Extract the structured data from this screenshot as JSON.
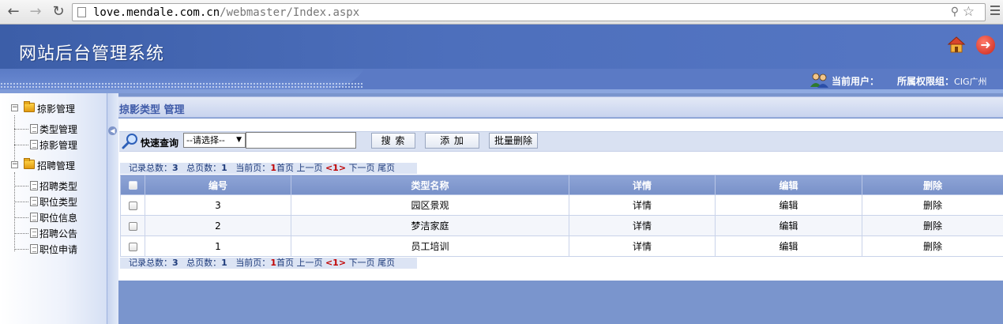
{
  "browser": {
    "url_host": "love.mendale.com.cn",
    "url_path": "/webmaster/Index.aspx"
  },
  "header": {
    "app_title": "网站后台管理系统",
    "current_user_label": "当前用户：",
    "group_label": "所属权限组：",
    "group_value": "CIG广州"
  },
  "sidebar": {
    "groups": [
      {
        "label": "掠影管理",
        "items": [
          "类型管理",
          "掠影管理"
        ]
      },
      {
        "label": "招聘管理",
        "items": [
          "招聘类型",
          "职位类型",
          "职位信息",
          "招聘公告",
          "职位申请"
        ]
      }
    ]
  },
  "panel": {
    "title": "掠影类型 管理"
  },
  "toolbar": {
    "quick_search_label": "快速查询",
    "select_value": "--请选择--",
    "search_value": "",
    "search_button": "搜 索",
    "add_button": "添 加",
    "batch_delete_button": "批量删除"
  },
  "pager": {
    "total_label": "记录总数：",
    "total": "3",
    "pages_label": "总页数：",
    "pages": "1",
    "current_label": "当前页：",
    "current": "1",
    "first": "首页",
    "prev": "上一页",
    "page_link": "<1>",
    "next": "下一页",
    "last": "尾页"
  },
  "table": {
    "columns": [
      "编号",
      "类型名称",
      "详情",
      "编辑",
      "删除"
    ],
    "rows": [
      {
        "id": "3",
        "name": "园区景观",
        "detail": "详情",
        "edit": "编辑",
        "delete": "删除"
      },
      {
        "id": "2",
        "name": "梦洁家庭",
        "detail": "详情",
        "edit": "编辑",
        "delete": "删除"
      },
      {
        "id": "1",
        "name": "员工培训",
        "detail": "详情",
        "edit": "编辑",
        "delete": "删除"
      }
    ]
  },
  "colors": {
    "header_blue": "#4d6fbc",
    "content_bg": "#7a95cd",
    "table_header": "#7790c8",
    "pager_current": "#c00000"
  }
}
